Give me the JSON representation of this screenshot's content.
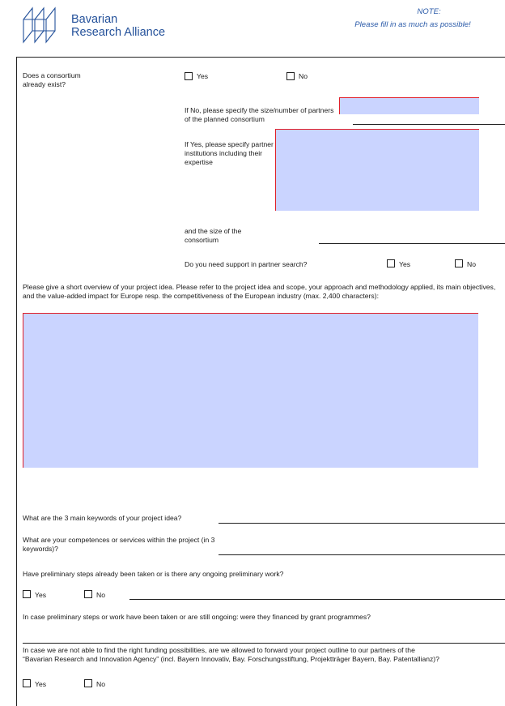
{
  "header": {
    "logo_line1": "Bavarian",
    "logo_line2": "Research Alliance",
    "note_title": "NOTE:",
    "note_text": "Please fill in as much as possible!"
  },
  "consortium": {
    "question": "Does a consortium already exist?",
    "yes": "Yes",
    "no": "No",
    "if_no_label": "If No, please specify the size/number of partners of the planned consortium",
    "if_yes_label": "If Yes, please specify partner institutions including their expertise",
    "size_label": "and the size of the consortium",
    "support_label": "Do you need support in partner search?",
    "support_yes": "Yes",
    "support_no": "No"
  },
  "overview": {
    "label": "Please give a short overview of your project idea. Please refer to the project idea and scope, your approach and methodology applied, its main objectives, and the value-added impact for Europe resp. the competitiveness of the European industry (max. 2,400 characters):"
  },
  "keywords": {
    "label": "What are the 3 main keywords of your project idea?"
  },
  "competences": {
    "label": "What are your competences or services within the project (in 3 keywords)?"
  },
  "preliminary": {
    "label": "Have preliminary steps already been taken or is there any ongoing preliminary work?",
    "yes": "Yes",
    "no": "No"
  },
  "financed": {
    "label": "In case preliminary steps or work have been taken or are still ongoing: were they financed by grant programmes?"
  },
  "forward": {
    "label_line1": "In case we are not able to find the right funding possibilities, are we allowed to forward your project outline to our partners of the",
    "label_line2": "“Bavarian Research and Innovation Agency” (incl. Bayern Innovativ, Bay. Forschungsstiftung, Projektträger Bayern, Bay. Patentallianz)?",
    "yes": "Yes",
    "no": "No"
  },
  "colors": {
    "field_fill": "#cad4ff",
    "field_border": "#e0202a",
    "logo_blue": "#24519a"
  }
}
